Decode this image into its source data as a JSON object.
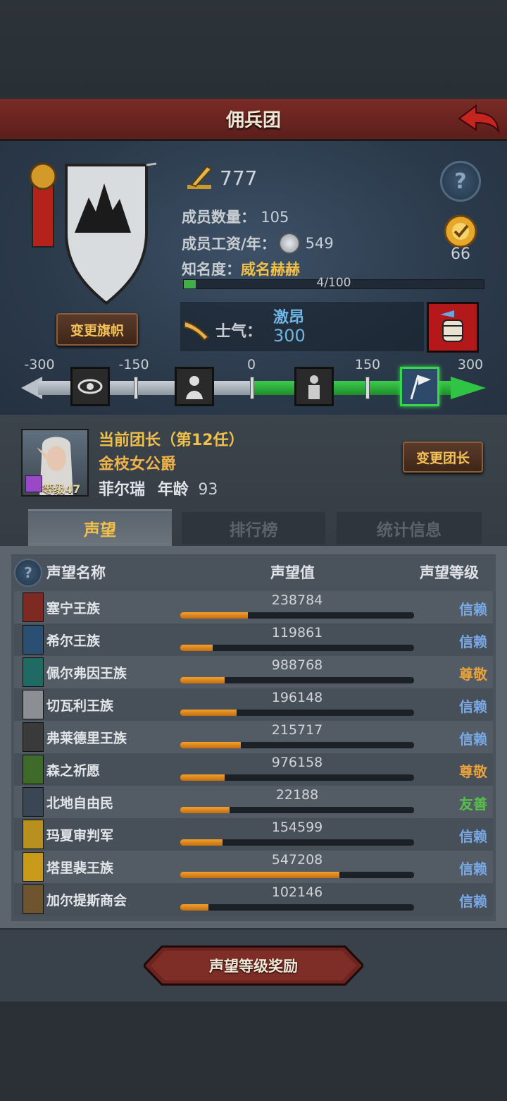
{
  "header": {
    "title": "佣兵团"
  },
  "guild": {
    "power": "777",
    "members_label": "成员数量：",
    "members_value": "105",
    "salary_label": "成员工资/年：",
    "salary_value": "549",
    "fame_label": "知名度：",
    "fame_value": "威名赫赫",
    "fame_progress_text": "4/100",
    "fame_progress": 0.04,
    "rank_value": "66",
    "change_flag_label": "变更旗帜"
  },
  "morale": {
    "label": "士气：",
    "state": "激昂",
    "value": "300",
    "scale_labels": [
      "-300",
      "-150",
      "0",
      "150",
      "300"
    ]
  },
  "leader": {
    "title": "当前团长（第12任）",
    "rank": "金枝女公爵",
    "name": "菲尔瑞",
    "age_label": "年龄",
    "age_value": "93",
    "level_text": "等级47",
    "change_leader_label": "变更团长"
  },
  "tabs": [
    {
      "label": "声望"
    },
    {
      "label": "排行榜"
    },
    {
      "label": "统计信息"
    }
  ],
  "table": {
    "headers": {
      "name": "声望名称",
      "value": "声望值",
      "level": "声望等级"
    },
    "rows": [
      {
        "name": "塞宁王族",
        "value": "238784",
        "level": "信赖",
        "fill": 0.29,
        "color": "#7d2a22",
        "level_color": "#7aa9e6"
      },
      {
        "name": "希尔王族",
        "value": "119861",
        "level": "信赖",
        "fill": 0.14,
        "color": "#2b4f73",
        "level_color": "#7aa9e6"
      },
      {
        "name": "佩尔弗因王族",
        "value": "988768",
        "level": "尊敬",
        "fill": 0.19,
        "color": "#1f6b64",
        "level_color": "#e8a23c"
      },
      {
        "name": "切瓦利王族",
        "value": "196148",
        "level": "信赖",
        "fill": 0.24,
        "color": "#8b8f94",
        "level_color": "#7aa9e6"
      },
      {
        "name": "弗莱德里王族",
        "value": "215717",
        "level": "信赖",
        "fill": 0.26,
        "color": "#3a3a3a",
        "level_color": "#7aa9e6"
      },
      {
        "name": "森之祈愿",
        "value": "976158",
        "level": "尊敬",
        "fill": 0.19,
        "color": "#3f6b2a",
        "level_color": "#e8a23c"
      },
      {
        "name": "北地自由民",
        "value": "22188",
        "level": "友善",
        "fill": 0.21,
        "color": "#3b4654",
        "level_color": "#58c04a"
      },
      {
        "name": "玛夏审判军",
        "value": "154599",
        "level": "信赖",
        "fill": 0.18,
        "color": "#b8901f",
        "level_color": "#7aa9e6"
      },
      {
        "name": "塔里裴王族",
        "value": "547208",
        "level": "信赖",
        "fill": 0.68,
        "color": "#c99a1a",
        "level_color": "#7aa9e6"
      },
      {
        "name": "加尔提斯商会",
        "value": "102146",
        "level": "信赖",
        "fill": 0.12,
        "color": "#6e5530",
        "level_color": "#7aa9e6"
      }
    ]
  },
  "footer": {
    "reward_button": "声望等级奖励"
  }
}
